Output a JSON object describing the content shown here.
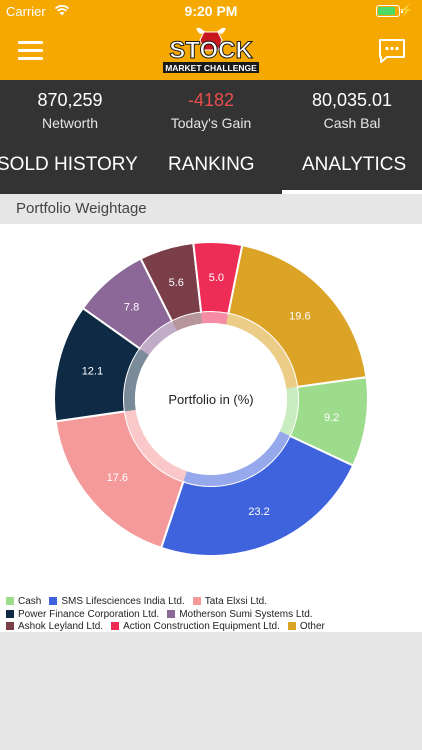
{
  "status_bar": {
    "carrier": "Carrier",
    "time": "9:20 PM"
  },
  "header": {
    "logo_top": "STOCK",
    "logo_bottom": "MARKET CHALLENGE"
  },
  "stats": [
    {
      "value": "870,259",
      "label": "Networth"
    },
    {
      "value": "-4182",
      "label": "Today's Gain"
    },
    {
      "value": "80,035.01",
      "label": "Cash Bal"
    }
  ],
  "tabs": [
    {
      "label": "SOLD HISTORY"
    },
    {
      "label": "RANKING"
    },
    {
      "label": "ANALYTICS",
      "active": true
    }
  ],
  "section": {
    "title": "Portfolio Weightage"
  },
  "chart_data": {
    "type": "pie",
    "donut": true,
    "center_label": "Portfolio in (%)",
    "slices": [
      {
        "name": "Cash",
        "value": 9.2,
        "color": "#9ddc8c"
      },
      {
        "name": "SMS Lifesciences India Ltd.",
        "value": 23.2,
        "color": "#3f62dd"
      },
      {
        "name": "Tata Elxsi Ltd.",
        "value": 17.6,
        "color": "#f59a9a"
      },
      {
        "name": "Power Finance Corporation Ltd.",
        "value": 12.1,
        "color": "#0f2a44"
      },
      {
        "name": "Motherson Sumi Systems Ltd.",
        "value": 7.8,
        "color": "#8c6898"
      },
      {
        "name": "Ashok Leyland Ltd.",
        "value": 5.6,
        "color": "#7a3e48"
      },
      {
        "name": "Action Construction Equipment Ltd.",
        "value": 5.0,
        "color": "#ee2d57"
      },
      {
        "name": "Other",
        "value": 19.6,
        "color": "#dca426"
      }
    ],
    "legend_rows": [
      [
        0,
        1,
        2
      ],
      [
        3,
        4
      ],
      [
        5,
        6,
        7
      ]
    ]
  },
  "theme": {
    "accent": "#f5a800",
    "dark": "#333333"
  }
}
